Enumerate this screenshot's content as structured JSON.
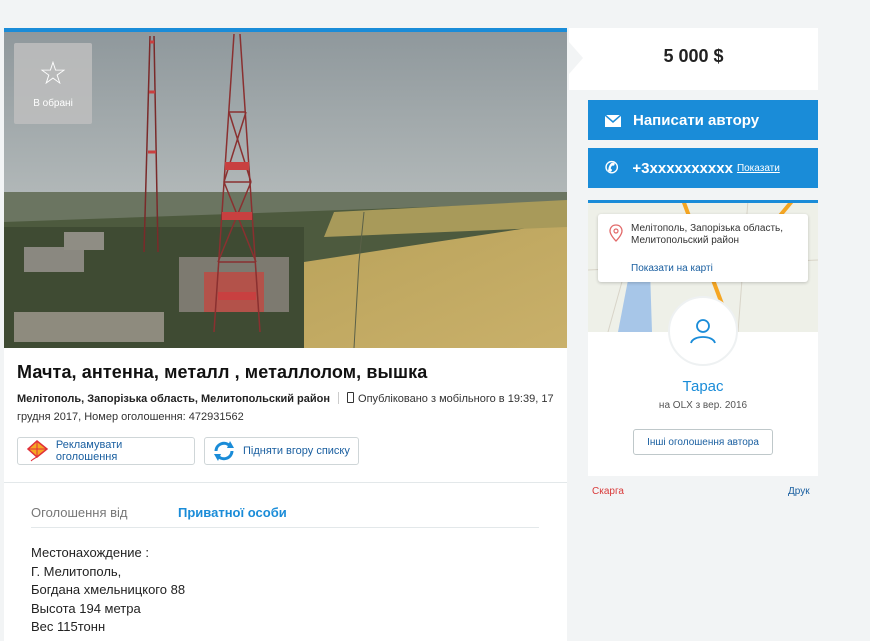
{
  "listing": {
    "favorite_label": "В обрані",
    "title": "Мачта, антенна, металл , металлолом, вышка",
    "location": "Мелітополь, Запорізька область, Мелитопольский район",
    "published": "Опубліковано з мобільного",
    "published_at": "в 19:39, 17 грудня 2017, Номер оголошення: 472931562",
    "promote_label": "Рекламувати оголошення",
    "bump_label": "Підняти вгору списку",
    "details": {
      "label": "Оголошення від",
      "value": "Приватної особи"
    },
    "description": [
      "Местонахождение :",
      "Г. Мелитополь,",
      "Богдана хмельницкого 88",
      "Высота 194 метра",
      "Вес 115тонн"
    ]
  },
  "sidebar": {
    "price": "5 000 $",
    "message_button": "Написати автору",
    "phone": "+3xxxxxxxxxx",
    "phone_show": "Показати",
    "map_address": "Мелітополь, Запорізька область, Мелитопольский район",
    "map_link": "Показати на карті",
    "user_name": "Тарас",
    "user_since": "на OLX з вер. 2016",
    "other_ads": "Інші оголошення автора",
    "complain": "Скарга",
    "print": "Друк"
  },
  "colors": {
    "accent": "#1a8cd8",
    "background": "#f2f4f5",
    "complain": "#d93a3a"
  }
}
